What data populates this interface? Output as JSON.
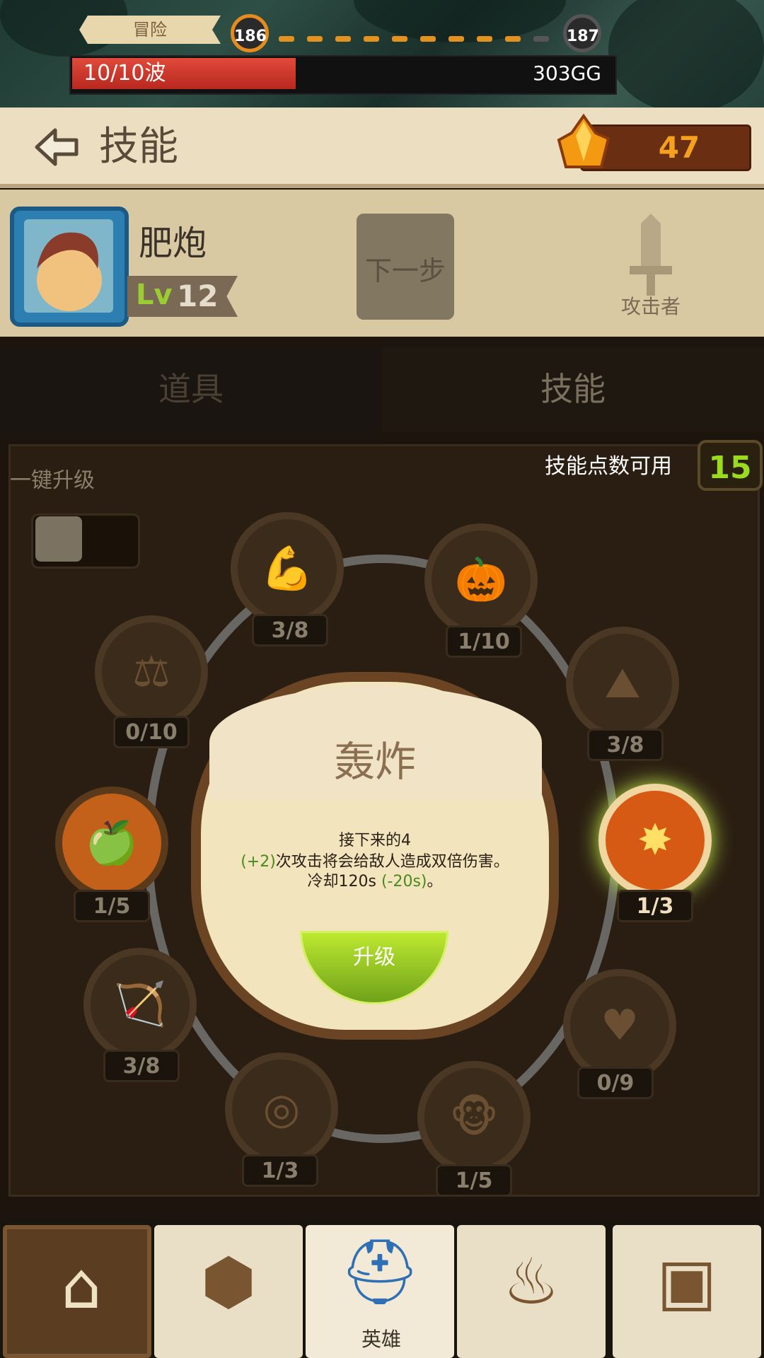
{
  "topbar": {
    "mode": "冒险",
    "current_level": "186",
    "next_level": "187",
    "wave": "10/10波",
    "wave_progress": 0.4,
    "gold": "303GG"
  },
  "header": {
    "back_icon": "back-arrow-icon",
    "title": "技能",
    "gems": "47"
  },
  "hero": {
    "name": "肥炮",
    "lv_prefix": "Lv",
    "level": "12",
    "next_label": "下一步",
    "role": "攻击者"
  },
  "tabs": [
    "道具",
    "技能"
  ],
  "skills_panel": {
    "points_label": "技能点数可用",
    "points": "15",
    "auto_upgrade_label": "一键升级",
    "nodes": [
      {
        "icon": "muscle-icon",
        "value": "3/8"
      },
      {
        "icon": "pumpkin-icon",
        "value": "1/10"
      },
      {
        "icon": "scales-icon",
        "value": "0/10"
      },
      {
        "icon": "island-icon",
        "value": "3/8"
      },
      {
        "icon": "apple-icon",
        "value": "1/5"
      },
      {
        "icon": "explosion-icon",
        "value": "1/3"
      },
      {
        "icon": "arrow-bow-icon",
        "value": "3/8"
      },
      {
        "icon": "heart-target-icon",
        "value": "0/9"
      },
      {
        "icon": "egg-icon",
        "value": "1/3"
      },
      {
        "icon": "monkey-icon",
        "value": "1/5"
      }
    ],
    "selected": {
      "name": "轰炸",
      "desc_line1": "接下来的4",
      "desc_bonus": "(+2)",
      "desc_line2": "次攻击将会给敌人造成双倍伤害。",
      "desc_line3_pre": "冷却120s ",
      "desc_cooldown_bonus": "(-20s)",
      "desc_line3_post": "。",
      "upgrade_label": "升级"
    }
  },
  "nav": {
    "items": [
      "home-icon",
      "stone-icon",
      "hero-helmet-icon",
      "cauldron-icon",
      "chest-icon"
    ],
    "hero_label": "英雄"
  }
}
